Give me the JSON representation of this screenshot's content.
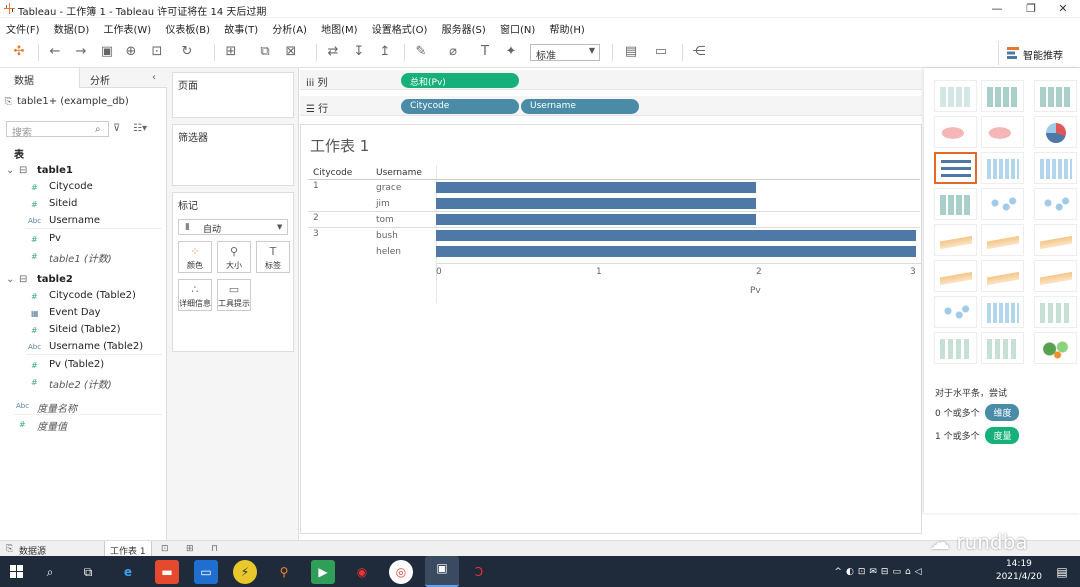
{
  "window": {
    "title": "Tableau - 工作簿 1 - Tableau 许可证将在 14 天后过期",
    "minimize": "—",
    "restore": "❐",
    "close": "✕"
  },
  "menu": [
    "文件(F)",
    "数据(D)",
    "工作表(W)",
    "仪表板(B)",
    "故事(T)",
    "分析(A)",
    "地图(M)",
    "设置格式(O)",
    "服务器(S)",
    "窗口(N)",
    "帮助(H)"
  ],
  "toolbar": {
    "fit_select": "标准",
    "smart_label": "智能推荐"
  },
  "left_pane": {
    "tab_data": "数据",
    "tab_analysis": "分析",
    "datasource": "table1+ (example_db)",
    "search_placeholder": "搜索",
    "tables_heading": "表",
    "table1": {
      "name": "table1",
      "fields": [
        "Citycode",
        "Siteid",
        "Username",
        "Pv",
        "table1 (计数)"
      ]
    },
    "table2": {
      "name": "table2",
      "fields": [
        "Citycode (Table2)",
        "Event Day",
        "Siteid (Table2)",
        "Username (Table2)",
        "Pv (Table2)",
        "table2 (计数)"
      ]
    },
    "measure_names": "度量名称",
    "measure_values": "度量值"
  },
  "shelves": {
    "pages": "页面",
    "filters": "筛选器",
    "marks": "标记",
    "mark_type": "自动",
    "mark_buttons": [
      "颜色",
      "大小",
      "标签",
      "详细信息",
      "工具提示"
    ],
    "columns_label": "列",
    "rows_label": "行",
    "columns_pill": "总和(Pv)",
    "rows_pills": [
      "Citycode",
      "Username"
    ]
  },
  "view": {
    "sheet_title": "工作表 1",
    "headers": [
      "Citycode",
      "Username"
    ],
    "axis_label": "Pv"
  },
  "chart_data": {
    "type": "bar",
    "orientation": "horizontal",
    "groups": [
      {
        "citycode": "1",
        "rows": [
          {
            "username": "grace",
            "pv": 2
          },
          {
            "username": "jim",
            "pv": 2
          }
        ]
      },
      {
        "citycode": "2",
        "rows": [
          {
            "username": "tom",
            "pv": 2
          }
        ]
      },
      {
        "citycode": "3",
        "rows": [
          {
            "username": "bush",
            "pv": 3
          },
          {
            "username": "helen",
            "pv": 3
          }
        ]
      }
    ],
    "xlabel": "Pv",
    "xlim": [
      0,
      3
    ],
    "xticks": [
      "0",
      "1",
      "2",
      "3"
    ],
    "bar_color": "#4e79a7"
  },
  "show_me": {
    "hint": "对于水平条，尝试",
    "dim_row": "0 个或多个",
    "dim_tag": "维度",
    "mea_row": "1 个或多个",
    "mea_tag": "度量"
  },
  "sheet_tabs": {
    "datasource": "数据源",
    "sheet1": "工作表 1"
  },
  "taskbar": {
    "time": "14:19",
    "date": "2021/4/20"
  },
  "watermark": "rundba"
}
